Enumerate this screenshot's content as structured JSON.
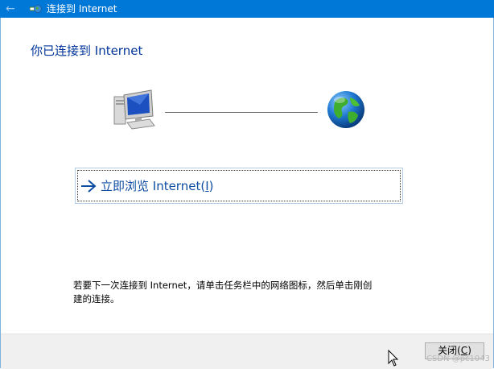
{
  "window": {
    "title": "连接到 Internet",
    "back_icon": "back-arrow-icon",
    "app_icon": "network-globe-icon"
  },
  "main": {
    "heading": "你已连接到 Internet",
    "status_icons": [
      "computer-icon",
      "globe-icon"
    ],
    "browse_link": {
      "text_before": "立即浏览 Internet(",
      "mnemonic": "I",
      "text_after": ")",
      "icon": "arrow-right-icon"
    },
    "hint": "若要下一次连接到 Internet，请单击任务栏中的网络图标，然后单击刚创建的连接。"
  },
  "footer": {
    "close_button": {
      "text_before": "关闭(",
      "mnemonic": "C",
      "text_after": ")"
    }
  },
  "watermark": "CSDN @pc1043",
  "colors": {
    "titlebar": "#0078d7",
    "heading": "#003399",
    "link": "#0c4da2",
    "footer_bg": "#f0f0f0"
  }
}
